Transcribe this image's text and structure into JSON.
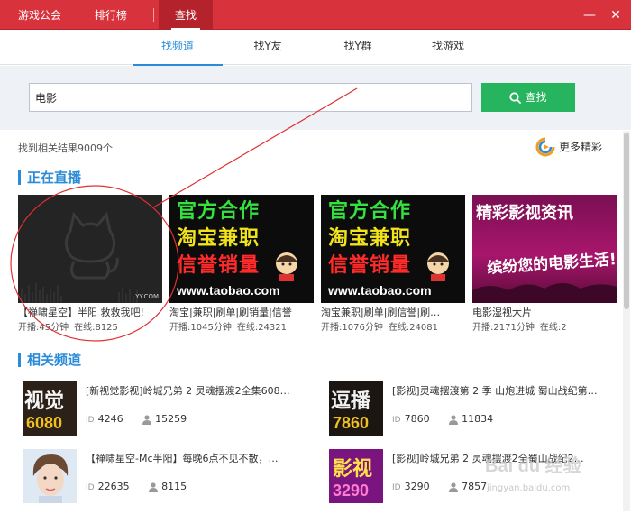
{
  "titlebar": {
    "tabs": [
      {
        "label": "游戏公会"
      },
      {
        "label": "排行榜"
      },
      {
        "label": "查找"
      }
    ],
    "minimize": "—",
    "close": "✕"
  },
  "subtabs": [
    {
      "label": "找频道"
    },
    {
      "label": "找Y友"
    },
    {
      "label": "找Y群"
    },
    {
      "label": "找游戏"
    }
  ],
  "search": {
    "value": "电影",
    "button_label": "查找"
  },
  "results": {
    "count_text": "找到相关结果9009个",
    "more_label": "更多精彩"
  },
  "live": {
    "heading": "正在直播",
    "cards": [
      {
        "title": "【禅啸星空】半阳  救救我吧!",
        "duration": "开播:45分钟",
        "online": "在线:8125",
        "thumb_mark": "YY.COM"
      },
      {
        "title": "淘宝|兼职|刷单|刷销量|信誉",
        "duration": "开播:1045分钟",
        "online": "在线:24321",
        "thumb_lines": [
          "官方合作",
          "淘宝兼职",
          "信誉销量"
        ],
        "thumb_url": "www.taobao.com"
      },
      {
        "title": "淘宝兼职|刷单|刷信誉|刷…",
        "duration": "开播:1076分钟",
        "online": "在线:24081",
        "thumb_lines": [
          "官方合作",
          "淘宝兼职",
          "信誉销量"
        ],
        "thumb_url": "www.taobao.com"
      },
      {
        "title": "电影湿视大片",
        "duration": "开播:2171分钟",
        "online": "在线:2",
        "thumb_lines": [
          "精彩影视资讯",
          "缤纷您的电影生活!"
        ]
      }
    ]
  },
  "related": {
    "heading": "相关频道",
    "items": [
      {
        "title": "[新视觉影视]岭城兄弟 2  灵魂摆渡2全集608…",
        "id_label": "ID",
        "id": "4246",
        "members": "15259",
        "logo_top": "视觉",
        "logo_bottom": "6080"
      },
      {
        "title": "[影视]灵魂摆渡第 2 季  山炮进城  蜀山战纪第…",
        "id_label": "ID",
        "id": "7860",
        "members": "11834",
        "logo_top": "逗播",
        "logo_bottom": "7860"
      },
      {
        "title": "【禅啸星空-Mc半阳】每晚6点不见不散，…",
        "id_label": "ID",
        "id": "22635",
        "members": "8115"
      },
      {
        "title": "[影视]岭城兄弟 2 灵魂摆渡2全蜀山战纪2…",
        "id_label": "ID",
        "id": "3290",
        "members": "7857",
        "logo_top": "影视",
        "logo_bottom": "3290"
      }
    ]
  },
  "watermark": {
    "brand": "Bai du 经验",
    "url": "jingyan.baidu.com"
  },
  "colors": {
    "titlebar": "#d8323c",
    "accent_blue": "#2a8bd8",
    "search_button": "#27b45f",
    "annotation_red": "#e03030"
  }
}
